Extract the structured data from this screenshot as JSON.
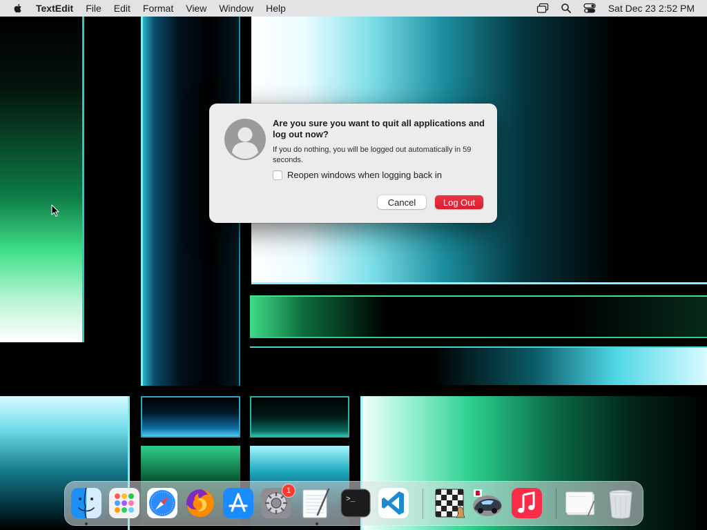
{
  "menubar": {
    "app_name": "TextEdit",
    "menus": [
      "File",
      "Edit",
      "Format",
      "View",
      "Window",
      "Help"
    ],
    "clock": "Sat Dec 23  2:52 PM"
  },
  "dialog": {
    "title": "Are you sure you want to quit all applications and log out now?",
    "message": "If you do nothing, you will be logged out automatically in 59 seconds.",
    "checkbox_label": "Reopen windows when logging back in",
    "checkbox_checked": false,
    "cancel_label": "Cancel",
    "logout_label": "Log Out"
  },
  "dock": {
    "items": [
      {
        "name": "finder-icon",
        "running": true
      },
      {
        "name": "launchpad-icon",
        "running": false
      },
      {
        "name": "safari-icon",
        "running": false
      },
      {
        "name": "firefox-icon",
        "running": false
      },
      {
        "name": "app-store-icon",
        "running": false
      },
      {
        "name": "system-settings-icon",
        "running": false,
        "badge": "1"
      },
      {
        "name": "textedit-icon",
        "running": true
      },
      {
        "name": "terminal-icon",
        "running": false
      },
      {
        "name": "vscode-icon",
        "running": false
      },
      {
        "name": "chess-icon",
        "running": false
      },
      {
        "name": "racing-game-icon",
        "running": false
      },
      {
        "name": "music-icon",
        "running": false
      },
      {
        "name": "document-stack-icon",
        "running": false
      },
      {
        "name": "trash-icon",
        "running": false
      }
    ],
    "terminal_prompt": ">_"
  },
  "colors": {
    "accent_red": "#d91f32",
    "dialog_bg": "#ececec",
    "menubar_bg": "#ececee"
  }
}
